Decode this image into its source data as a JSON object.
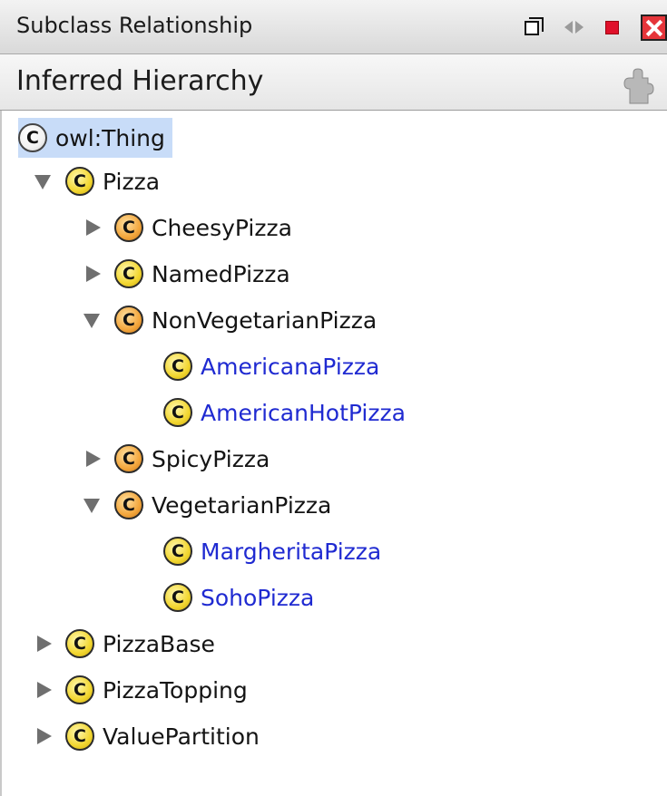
{
  "window": {
    "title": "Subclass Relationship",
    "buttons": [
      "restore-icon",
      "arrows-icon",
      "stop-icon",
      "close-icon"
    ],
    "close_color": "#e5353a",
    "stop_color": "#e0102a"
  },
  "header": {
    "title": "Inferred Hierarchy",
    "icon": "puzzle-icon"
  },
  "tree": {
    "root": {
      "label": "owl:Thing",
      "icon": "class-white",
      "selected": true,
      "selection_color": "#c8dcf8"
    },
    "inferred_color": "#1f2ad1",
    "nodes": [
      {
        "label": "Pizza",
        "depth": 1,
        "state": "expanded",
        "icon": "class-yellow",
        "inferred": false
      },
      {
        "label": "CheesyPizza",
        "depth": 2,
        "state": "collapsed",
        "icon": "class-orange",
        "inferred": false
      },
      {
        "label": "NamedPizza",
        "depth": 2,
        "state": "collapsed",
        "icon": "class-yellow",
        "inferred": false
      },
      {
        "label": "NonVegetarianPizza",
        "depth": 2,
        "state": "expanded",
        "icon": "class-orange",
        "inferred": false
      },
      {
        "label": "AmericanaPizza",
        "depth": 3,
        "state": "leaf",
        "icon": "class-yellow",
        "inferred": true
      },
      {
        "label": "AmericanHotPizza",
        "depth": 3,
        "state": "leaf",
        "icon": "class-yellow",
        "inferred": true
      },
      {
        "label": "SpicyPizza",
        "depth": 2,
        "state": "collapsed",
        "icon": "class-orange",
        "inferred": false
      },
      {
        "label": "VegetarianPizza",
        "depth": 2,
        "state": "expanded",
        "icon": "class-orange",
        "inferred": false
      },
      {
        "label": "MargheritaPizza",
        "depth": 3,
        "state": "leaf",
        "icon": "class-yellow",
        "inferred": true
      },
      {
        "label": "SohoPizza",
        "depth": 3,
        "state": "leaf",
        "icon": "class-yellow",
        "inferred": true
      },
      {
        "label": "PizzaBase",
        "depth": 1,
        "state": "collapsed",
        "icon": "class-yellow",
        "inferred": false
      },
      {
        "label": "PizzaTopping",
        "depth": 1,
        "state": "collapsed",
        "icon": "class-yellow",
        "inferred": false
      },
      {
        "label": "ValuePartition",
        "depth": 1,
        "state": "collapsed",
        "icon": "class-yellow",
        "inferred": false
      }
    ]
  }
}
